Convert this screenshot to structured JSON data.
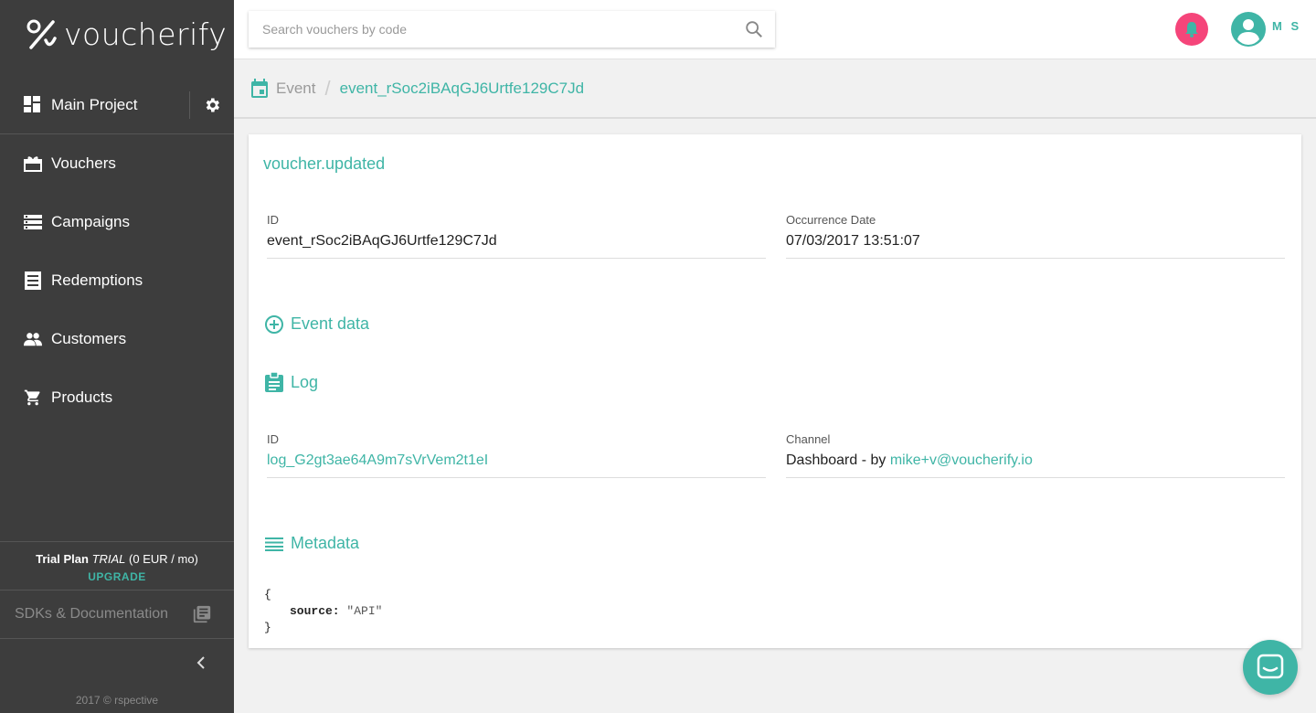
{
  "brand": {
    "name": "voucherify",
    "accent": "#3fb5a6",
    "sidebar_bg": "#3d3d3d"
  },
  "sidebar": {
    "project": "Main Project",
    "items": [
      {
        "label": "Vouchers",
        "icon": "voucher-icon"
      },
      {
        "label": "Campaigns",
        "icon": "list-icon"
      },
      {
        "label": "Redemptions",
        "icon": "receipt-icon"
      },
      {
        "label": "Customers",
        "icon": "people-icon"
      },
      {
        "label": "Products",
        "icon": "cart-icon"
      }
    ],
    "plan": {
      "name": "Trial Plan",
      "type": "TRIAL",
      "price": "(0 EUR / mo)",
      "upgrade": "UPGRADE"
    },
    "sdk": "SDKs & Documentation",
    "copyright": "2017 © rspective"
  },
  "topbar": {
    "search_placeholder": "Search vouchers by code",
    "user_initials": "M S",
    "notif_color": "#f5457a"
  },
  "breadcrumb": {
    "section": "Event",
    "current": "event_rSoc2iBAqGJ6Urtfe129C7Jd"
  },
  "event": {
    "title": "voucher.updated",
    "id_label": "ID",
    "id_value": "event_rSoc2iBAqGJ6Urtfe129C7Jd",
    "date_label": "Occurrence Date",
    "date_value": "07/03/2017 13:51:07"
  },
  "sections": {
    "event_data": "Event data",
    "log": "Log",
    "metadata": "Metadata"
  },
  "log": {
    "id_label": "ID",
    "id_value": "log_G2gt3ae64A9m7sVrVem2t1eI",
    "channel_label": "Channel",
    "channel_prefix": "Dashboard - by ",
    "channel_user": "mike+v@voucherify.io"
  },
  "metadata": {
    "open": "{",
    "key": "source:",
    "value": "\"API\"",
    "close": "}"
  }
}
